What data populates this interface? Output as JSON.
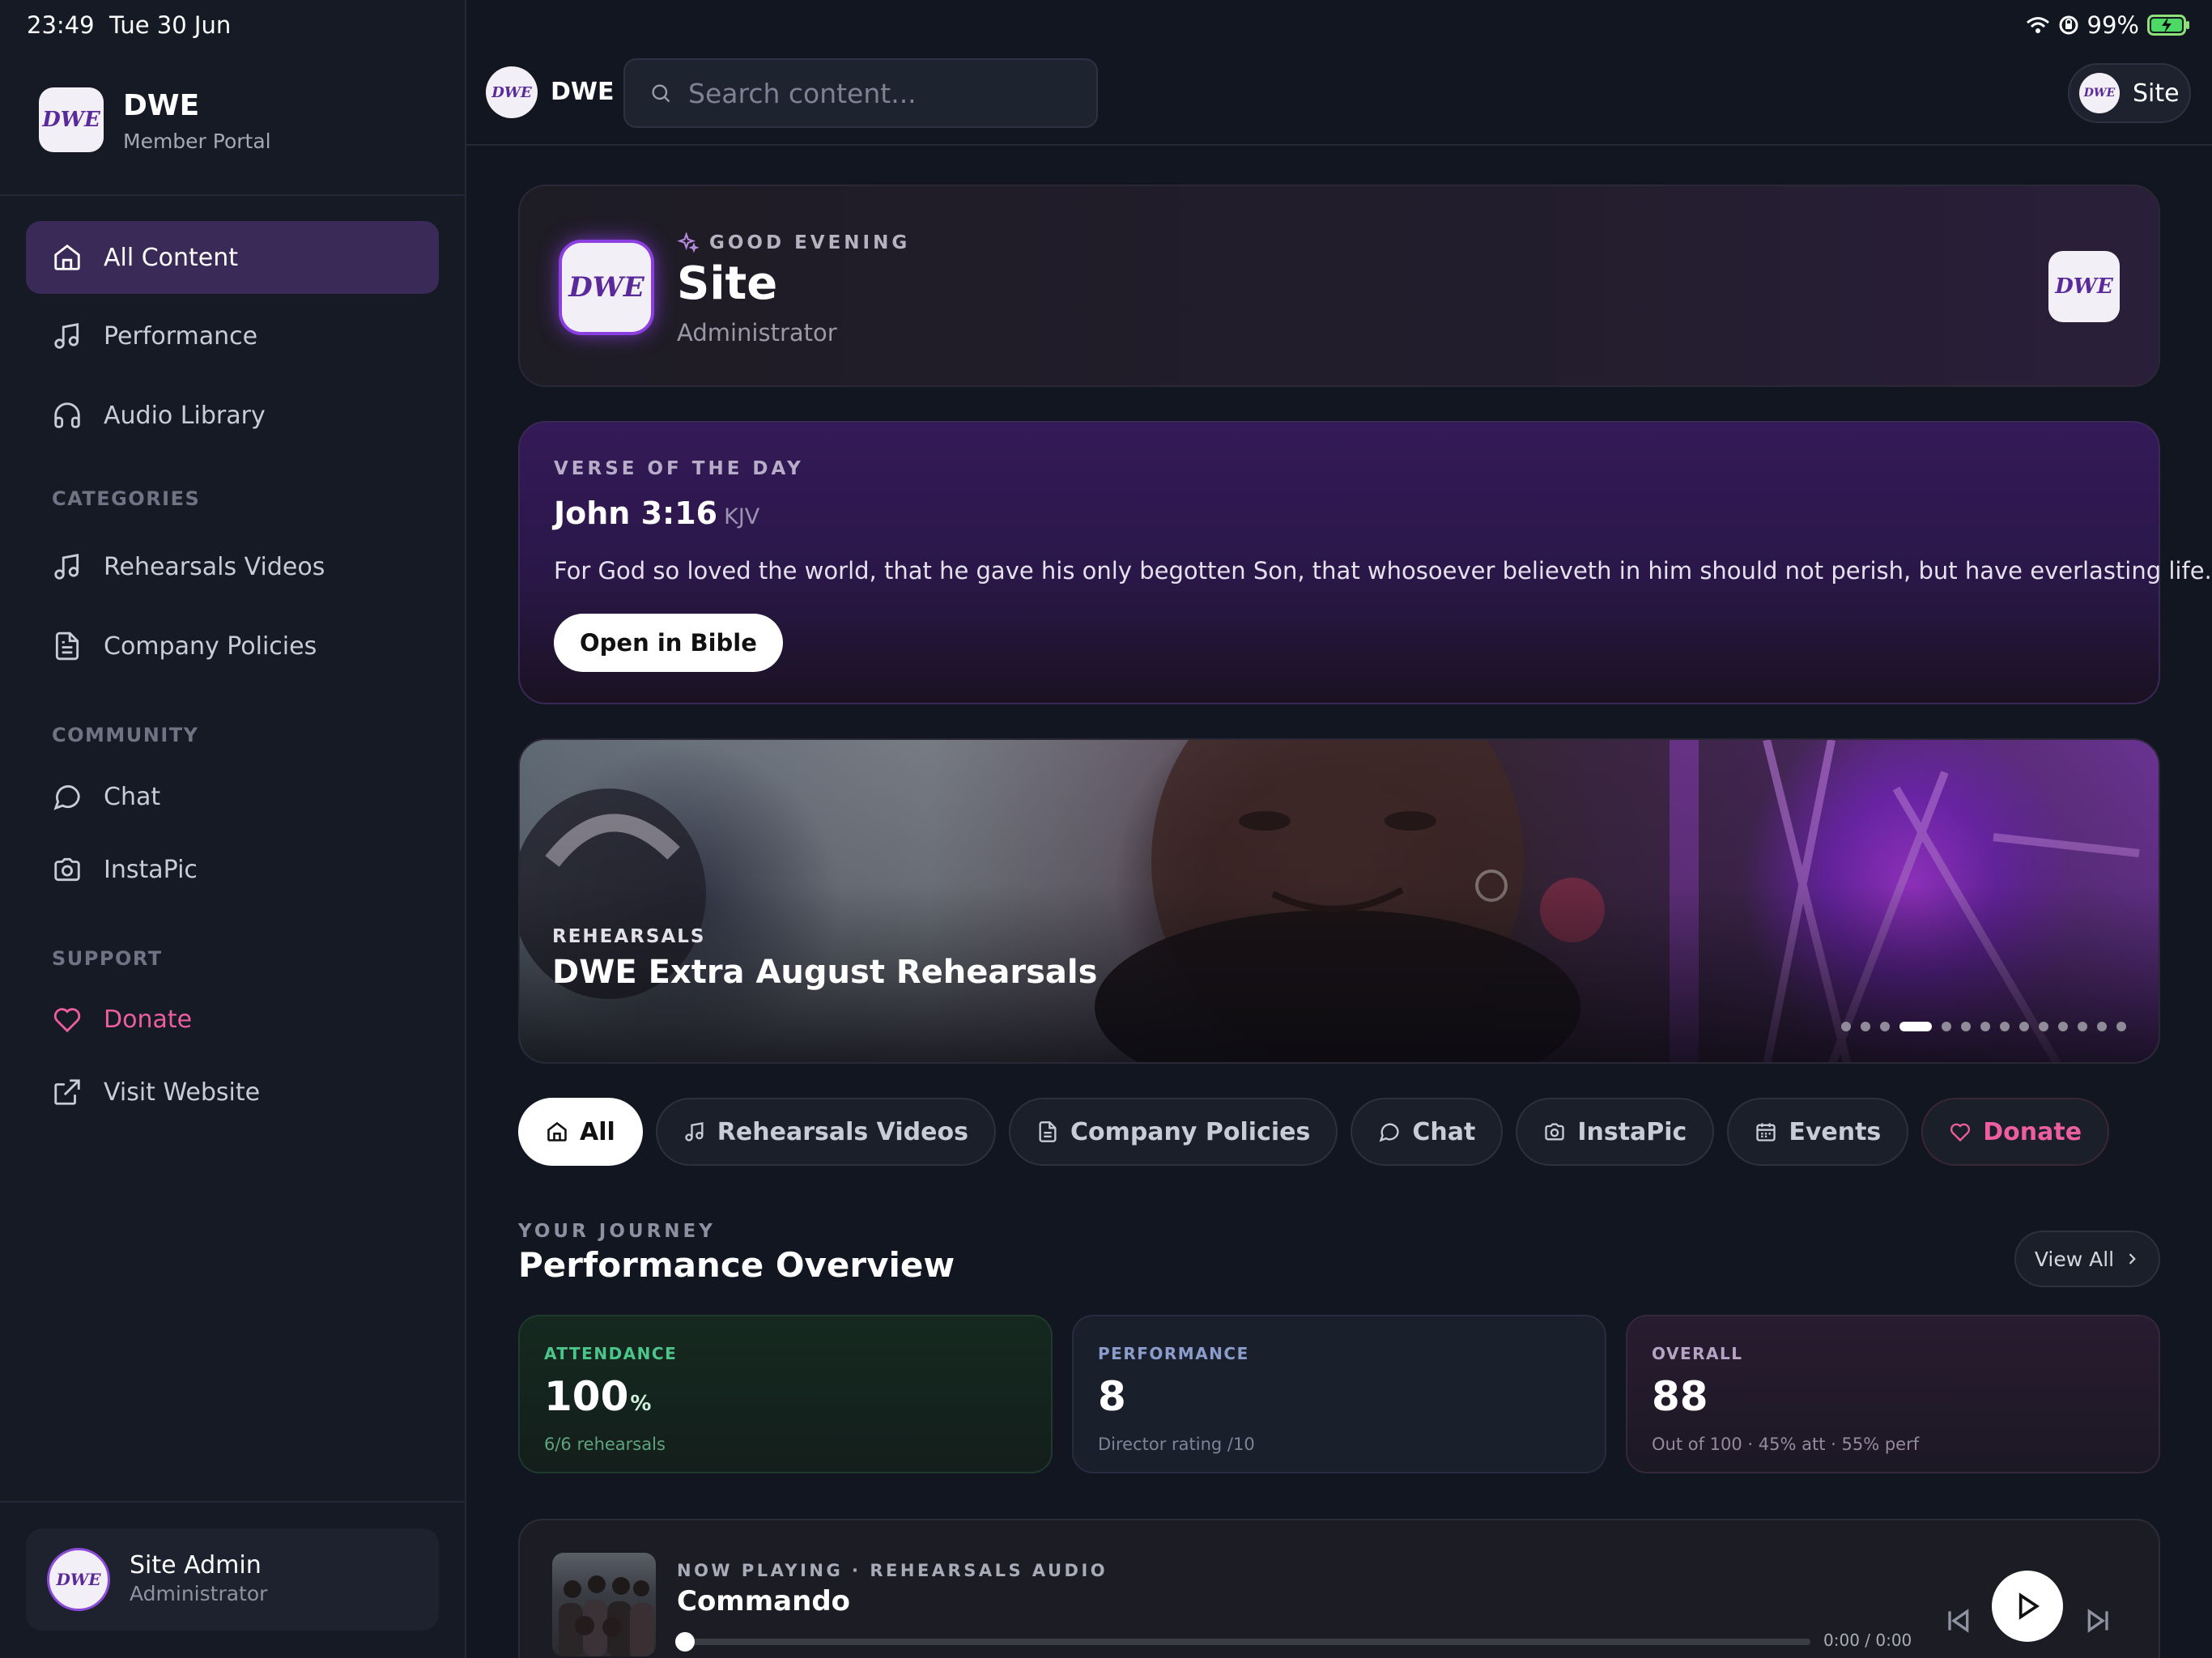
{
  "status_bar": {
    "time": "23:49",
    "date": "Tue 30 Jun",
    "battery": "99%"
  },
  "brand": {
    "logo": "DWE",
    "name": "DWE",
    "subtitle": "Member Portal"
  },
  "sidebar": {
    "main_items": [
      {
        "label": "All Content",
        "icon": "home-icon",
        "active": true
      },
      {
        "label": "Performance",
        "icon": "music-note-icon"
      },
      {
        "label": "Audio Library",
        "icon": "headphones-icon"
      }
    ],
    "categories_label": "CATEGORIES",
    "categories": [
      {
        "label": "Rehearsals Videos",
        "icon": "music-note-icon"
      },
      {
        "label": "Company Policies",
        "icon": "document-icon"
      }
    ],
    "community_label": "COMMUNITY",
    "community": [
      {
        "label": "Chat",
        "icon": "chat-bubble-icon"
      },
      {
        "label": "InstaPic",
        "icon": "camera-icon"
      }
    ],
    "support_label": "SUPPORT",
    "support": [
      {
        "label": "Donate",
        "icon": "heart-icon",
        "accent": "#ec5ea0"
      },
      {
        "label": "Visit Website",
        "icon": "external-link-icon"
      }
    ],
    "user": {
      "name": "Site Admin",
      "role": "Administrator"
    }
  },
  "topbar": {
    "name": "DWE",
    "search_placeholder": "Search content...",
    "account_label": "Site"
  },
  "greeting": {
    "kicker": "GOOD EVENING",
    "name": "Site",
    "role": "Administrator"
  },
  "verse": {
    "kicker": "VERSE OF THE DAY",
    "reference": "John 3:16",
    "version": "KJV",
    "text": "For God so loved the world, that he gave his only begotten Son, that whosoever believeth in him should not perish, but have everlasting life.",
    "button": "Open in Bible"
  },
  "hero": {
    "kicker": "REHEARSALS",
    "title": "DWE Extra August Rehearsals",
    "slide_count": 14,
    "active_slide": 4
  },
  "filters": [
    {
      "label": "All",
      "icon": "home-icon",
      "active": true
    },
    {
      "label": "Rehearsals Videos",
      "icon": "music-note-icon"
    },
    {
      "label": "Company Policies",
      "icon": "document-icon"
    },
    {
      "label": "Chat",
      "icon": "chat-bubble-icon"
    },
    {
      "label": "InstaPic",
      "icon": "camera-icon"
    },
    {
      "label": "Events",
      "icon": "calendar-icon"
    },
    {
      "label": "Donate",
      "icon": "heart-icon",
      "accent": "#ec5ea0"
    }
  ],
  "journey": {
    "kicker": "YOUR JOURNEY",
    "title": "Performance Overview",
    "view_all": "View All",
    "stats": {
      "attendance": {
        "label": "ATTENDANCE",
        "value": "100",
        "unit": "%",
        "sub": "6/6 rehearsals"
      },
      "performance": {
        "label": "PERFORMANCE",
        "value": "8",
        "sub": "Director rating /10"
      },
      "overall": {
        "label": "OVERALL",
        "value": "88",
        "sub": "Out of 100 · 45% att · 55% perf"
      }
    }
  },
  "player": {
    "kicker": "NOW PLAYING · REHEARSALS AUDIO",
    "title": "Commando",
    "time": "0:00 / 0:00",
    "progress": 0
  },
  "colors": {
    "accent_purple": "#3a2a58",
    "donate_pink": "#ec5ea0",
    "attendance_green": "#4cc58a"
  }
}
